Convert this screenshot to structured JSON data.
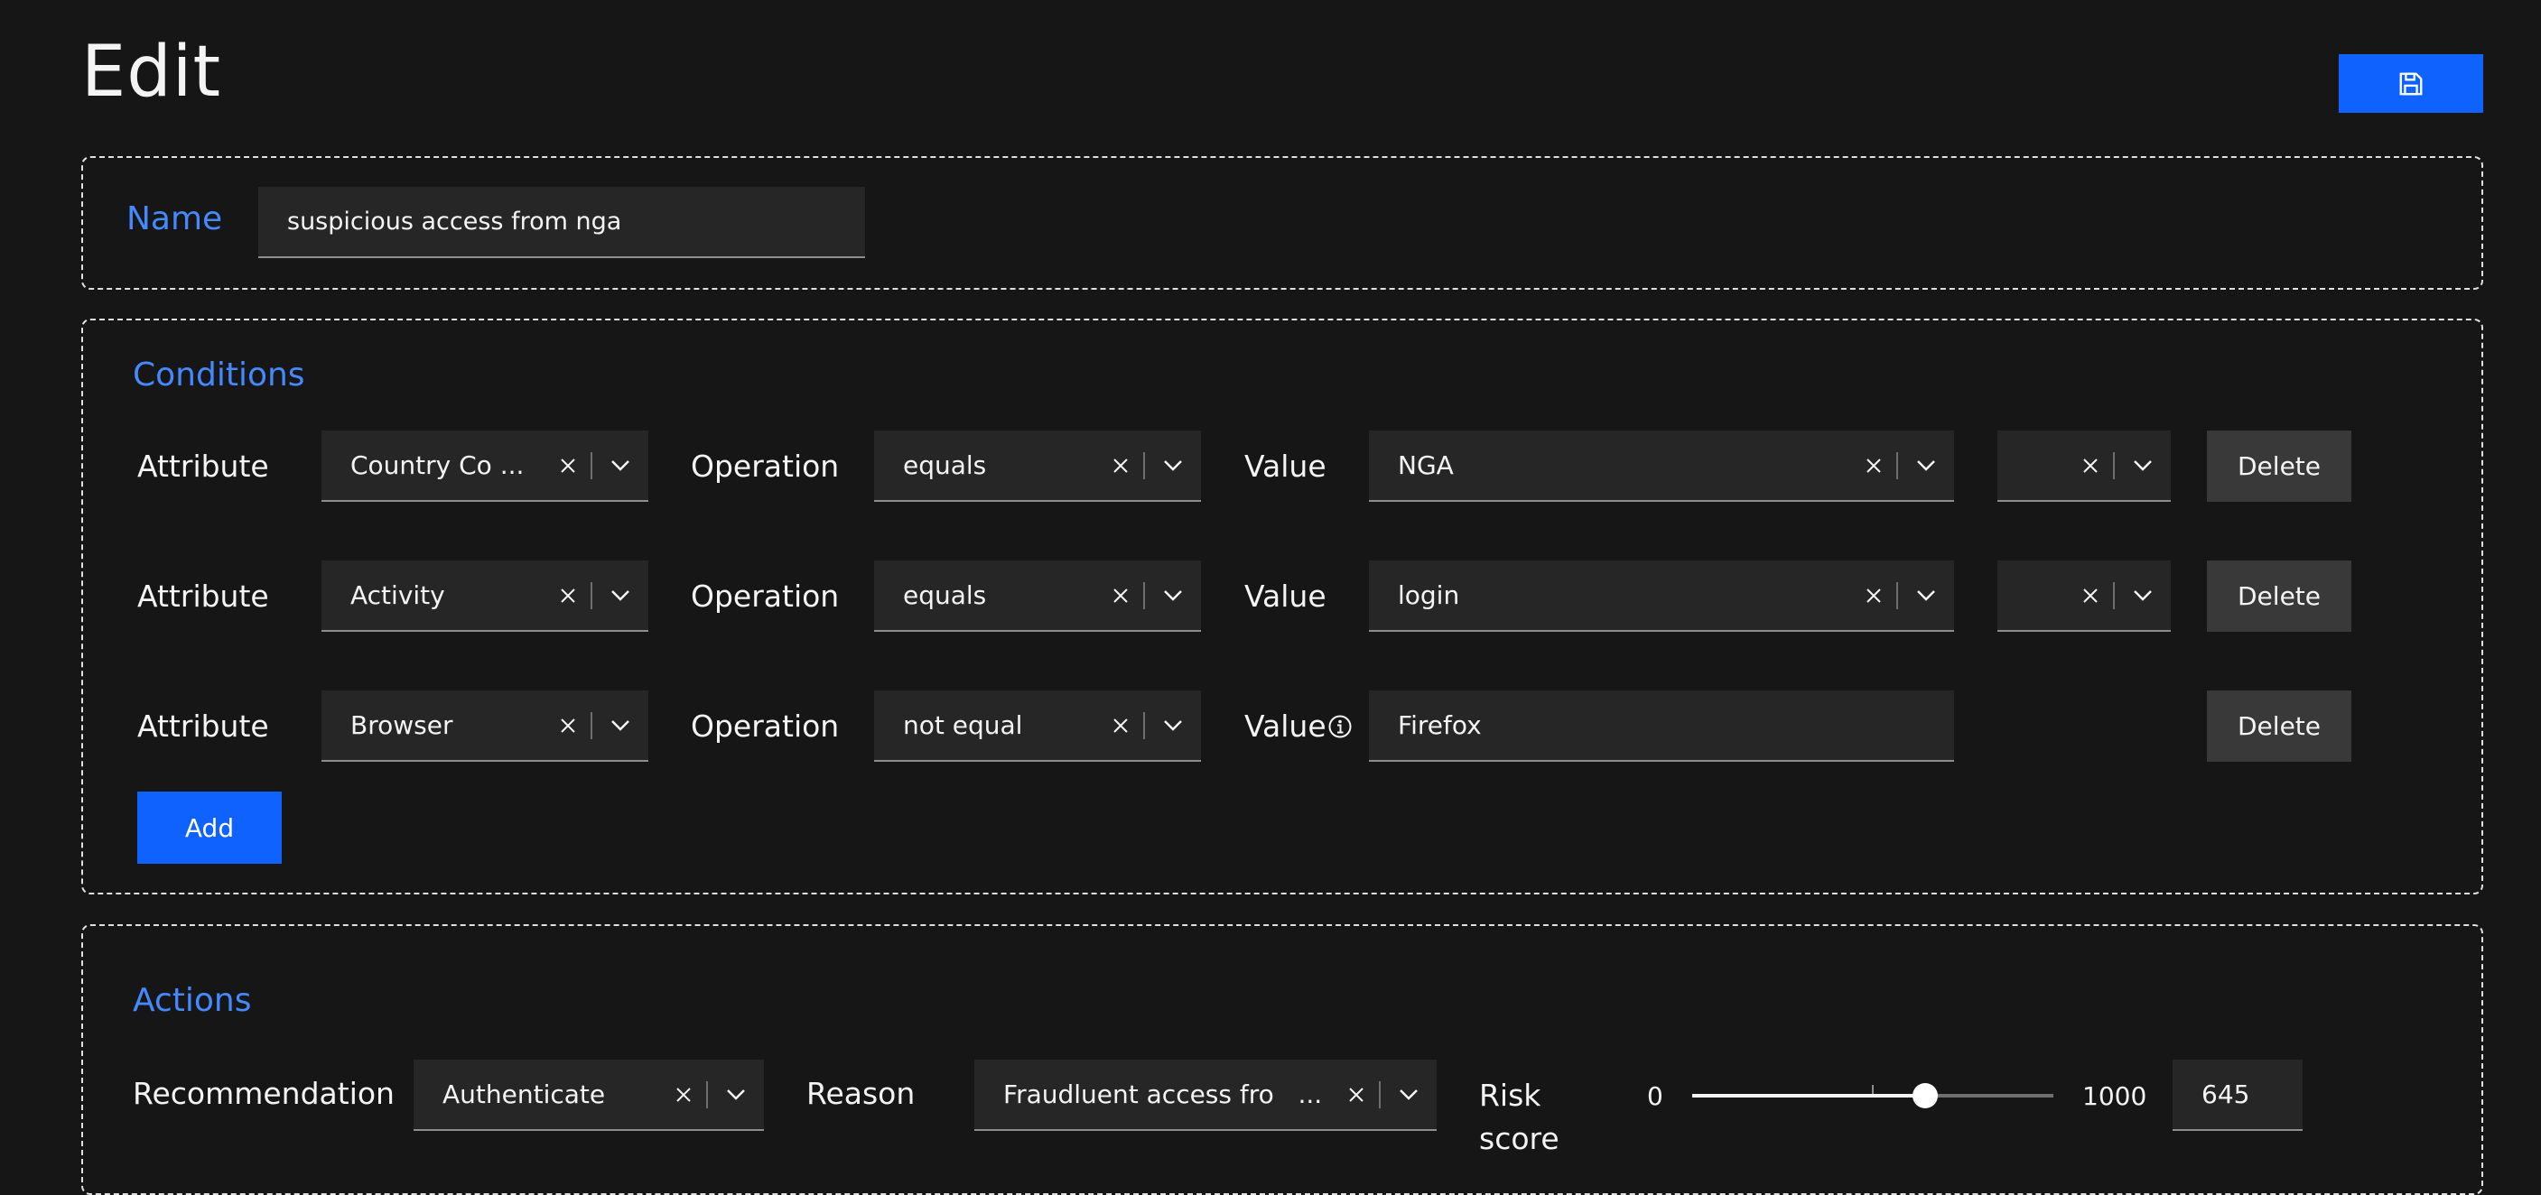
{
  "header": {
    "title": "Edit",
    "save_icon": "save-icon"
  },
  "name_section": {
    "label": "Name",
    "value": "suspicious access from nga"
  },
  "conditions": {
    "heading": "Conditions",
    "rows": [
      {
        "attr_label": "Attribute",
        "attribute": "Country Co ...",
        "op_label": "Operation",
        "operation": "equals",
        "value_label": "Value",
        "value": "NGA",
        "extra": "",
        "delete": "Delete"
      },
      {
        "attr_label": "Attribute",
        "attribute": "Activity",
        "op_label": "Operation",
        "operation": "equals",
        "value_label": "Value",
        "value": "login",
        "extra": "",
        "delete": "Delete"
      },
      {
        "attr_label": "Attribute",
        "attribute": "Browser",
        "op_label": "Operation",
        "operation": "not equal",
        "value_label": "Value",
        "value": "Firefox",
        "delete": "Delete"
      }
    ],
    "add": "Add"
  },
  "actions": {
    "heading": "Actions",
    "recommendation_label": "Recommendation",
    "recommendation": "Authenticate",
    "reason_label": "Reason",
    "reason": "Fraudluent access fro   ...",
    "risk_label_1": "Risk",
    "risk_label_2": "score",
    "slider_min": "0",
    "slider_max": "1000",
    "risk_value": "645",
    "risk_fraction": 0.645
  },
  "colors": {
    "accent": "#0f62fe",
    "label_blue": "#4589ff",
    "background": "#161616",
    "field": "#262626"
  }
}
